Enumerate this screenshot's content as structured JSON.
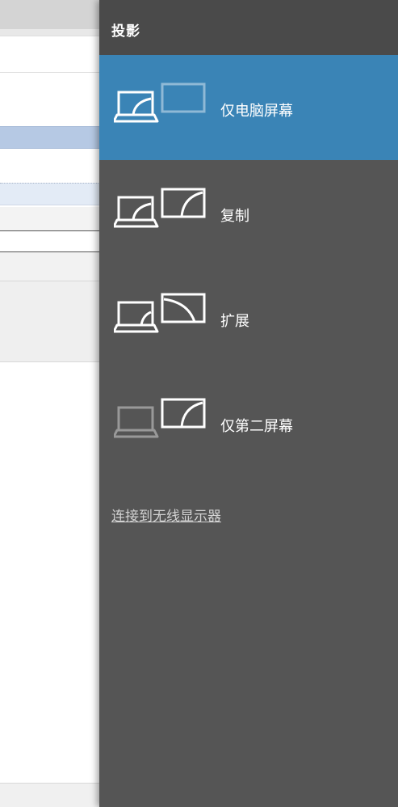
{
  "flyout": {
    "title": "投影",
    "options": [
      {
        "label": "仅电脑屏幕",
        "selected": true,
        "icon": "pc-screen-only-icon"
      },
      {
        "label": "复制",
        "selected": false,
        "icon": "duplicate-icon"
      },
      {
        "label": "扩展",
        "selected": false,
        "icon": "extend-icon"
      },
      {
        "label": "仅第二屏幕",
        "selected": false,
        "icon": "second-screen-only-icon"
      }
    ],
    "wireless_link": "连接到无线显示器"
  },
  "colors": {
    "flyout_bg": "#555555",
    "header_bg": "#4a4a4a",
    "accent_selected": "#3a84b6",
    "link": "#d2d2d2"
  }
}
